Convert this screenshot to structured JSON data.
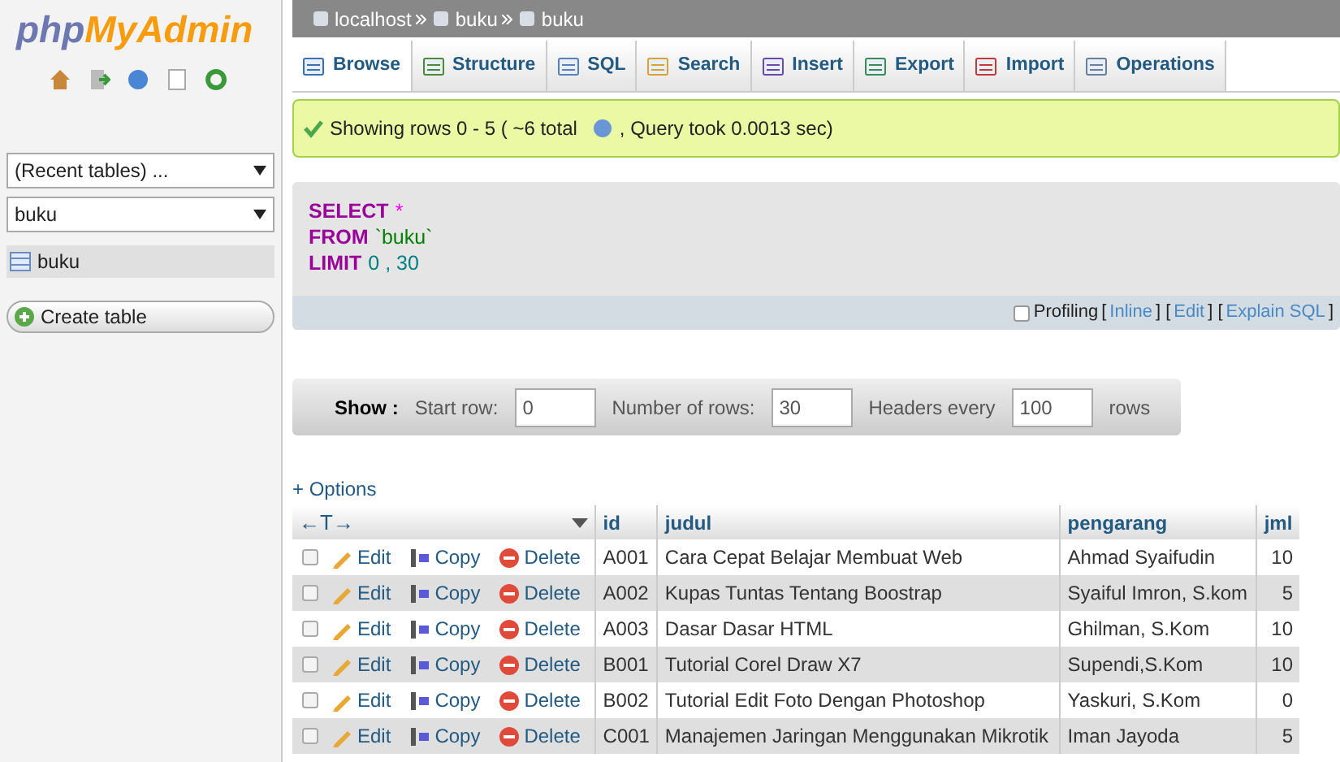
{
  "sidebar": {
    "logo": {
      "part_1": "php",
      "part_2": "MyAdmin"
    },
    "recent_select": "(Recent tables) ...",
    "database_select": "buku",
    "tables": [
      {
        "name": "buku",
        "selected": true
      }
    ],
    "create_button": "Create table"
  },
  "breadcrumb": [
    "localhost",
    "buku",
    "buku"
  ],
  "tabs": [
    {
      "label": "Browse",
      "selected": true
    },
    {
      "label": "Structure",
      "selected": false
    },
    {
      "label": "SQL",
      "selected": false
    },
    {
      "label": "Search",
      "selected": false
    },
    {
      "label": "Insert",
      "selected": false
    },
    {
      "label": "Export",
      "selected": false
    },
    {
      "label": "Import",
      "selected": false
    },
    {
      "label": "Operations",
      "selected": false
    }
  ],
  "message": {
    "text_1": "Showing rows 0 - 5 ( ~6 total",
    "text_2": ", Query took 0.0013 sec)"
  },
  "sql": [
    {
      "keyword": "SELECT",
      "arg": "*"
    },
    {
      "keyword": "FROM",
      "arg": "`buku`"
    },
    {
      "keyword": "LIMIT",
      "arg": "0 , 30"
    }
  ],
  "sql_footer": {
    "profiling_label": "Profiling",
    "profiling_checked": false,
    "parts": [
      {
        "kind": "text",
        "text": "["
      },
      {
        "kind": "link",
        "text": "Inline"
      },
      {
        "kind": "text",
        "text": "] ["
      },
      {
        "kind": "link",
        "text": "Edit"
      },
      {
        "kind": "text",
        "text": "] ["
      },
      {
        "kind": "link",
        "text": "Explain SQL"
      },
      {
        "kind": "text",
        "text": "]"
      }
    ]
  },
  "show_bar": {
    "label": "Show :",
    "start_label": "Start row:",
    "start_value": "0",
    "rows_label": "Number of rows:",
    "rows_value": "30",
    "headers_label": "Headers every",
    "headers_value": "100",
    "suffix": "rows"
  },
  "options_link": "+ Options",
  "table": {
    "expand_control": "←T→",
    "columns": [
      "id",
      "judul",
      "pengarang",
      "jml"
    ],
    "rows": [
      {
        "checked": false,
        "actions": [
          "Edit",
          "Copy",
          "Delete"
        ],
        "cells": [
          "A001",
          "Cara Cepat Belajar Membuat Web",
          "Ahmad Syaifudin",
          "10"
        ]
      },
      {
        "checked": false,
        "actions": [
          "Edit",
          "Copy",
          "Delete"
        ],
        "cells": [
          "A002",
          "Kupas Tuntas Tentang Boostrap",
          "Syaiful Imron, S.kom",
          "5"
        ]
      },
      {
        "checked": false,
        "actions": [
          "Edit",
          "Copy",
          "Delete"
        ],
        "cells": [
          "A003",
          "Dasar Dasar HTML",
          "Ghilman, S.Kom",
          "10"
        ]
      },
      {
        "checked": false,
        "actions": [
          "Edit",
          "Copy",
          "Delete"
        ],
        "cells": [
          "B001",
          "Tutorial Corel Draw X7",
          "Supendi,S.Kom",
          "10"
        ]
      },
      {
        "checked": false,
        "actions": [
          "Edit",
          "Copy",
          "Delete"
        ],
        "cells": [
          "B002",
          "Tutorial Edit Foto Dengan Photoshop",
          "Yaskuri, S.Kom",
          "0"
        ]
      },
      {
        "checked": false,
        "actions": [
          "Edit",
          "Copy",
          "Delete"
        ],
        "cells": [
          "C001",
          "Manajemen Jaringan Menggunakan Mikrotik",
          "Iman Jayoda",
          "5"
        ]
      }
    ]
  }
}
